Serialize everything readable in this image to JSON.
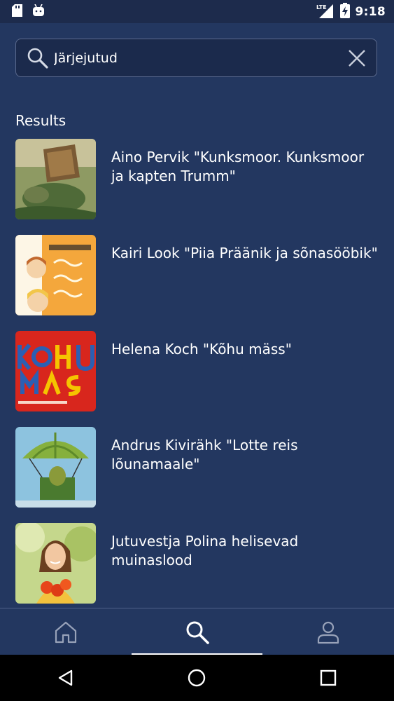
{
  "status_bar": {
    "time": "9:18",
    "network": "LTE",
    "icons": [
      "sd-card-icon",
      "android-debug-icon",
      "lte-signal-icon",
      "battery-charging-icon"
    ]
  },
  "search": {
    "value": "Järjejutud",
    "placeholder": "Järjejutud"
  },
  "results": {
    "heading": "Results",
    "items": [
      {
        "title": "Aino Pervik \"Kunksmoor. Kunksmoor ja kapten Trumm\"",
        "thumbnail_colors": [
          "#6b7d4a",
          "#b08a4f",
          "#3b4c2f"
        ]
      },
      {
        "title": "Kairi Look \"Piia Präänik ja sõnasööbik\"",
        "thumbnail_colors": [
          "#f3a43a",
          "#f6d98a",
          "#ffffff"
        ]
      },
      {
        "title": "Helena Koch \"Kõhu mäss\"",
        "thumbnail_colors": [
          "#d9261c",
          "#f4c200",
          "#2a5fb0"
        ]
      },
      {
        "title": "Andrus Kivirähk \"Lotte reis lõunamaale\"",
        "thumbnail_colors": [
          "#8cc2dd",
          "#76a23a",
          "#3e6f2a"
        ]
      },
      {
        "title": "Jutuvestja Polina helisevad muinaslood",
        "thumbnail_colors": [
          "#c9d98a",
          "#e85a1b",
          "#f4c23c"
        ]
      }
    ]
  },
  "bottom_nav": {
    "items": [
      "home",
      "search",
      "profile"
    ],
    "active": "search"
  },
  "colors": {
    "background": "#233760",
    "status_bar": "#1d2b4c",
    "accent": "#ffffff"
  }
}
